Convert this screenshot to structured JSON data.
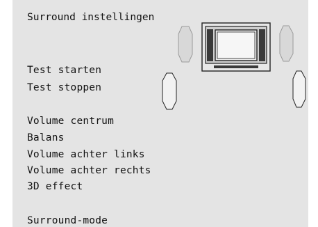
{
  "menu": {
    "title": "Surround instellingen",
    "items": [
      {
        "label": "Test starten"
      },
      {
        "label": "Test stoppen"
      },
      {
        "label": "Volume centrum"
      },
      {
        "label": "Balans"
      },
      {
        "label": "Volume achter links"
      },
      {
        "label": "Volume achter rechts"
      },
      {
        "label": "3D effect"
      },
      {
        "label": "Surround-mode"
      }
    ]
  },
  "icons": {
    "speaker_layout": "speaker-layout-icon",
    "tv": "tv-icon",
    "front_left": "front-left-speaker-icon",
    "front_right": "front-right-speaker-icon",
    "rear_left": "rear-left-speaker-icon",
    "rear_right": "rear-right-speaker-icon"
  },
  "colors": {
    "background": "#e4e4e4",
    "text": "#111111",
    "speaker_front_fill": "#d8d8d8",
    "speaker_rear_fill": "#f2f2f2"
  }
}
